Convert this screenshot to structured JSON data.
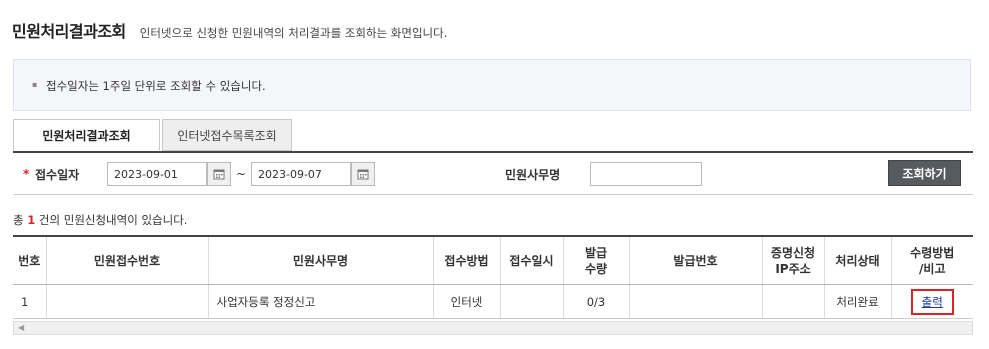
{
  "page": {
    "title": "민원처리결과조회",
    "description": "인터넷으로 신청한 민원내역의 처리결과를 조회하는 화면입니다."
  },
  "notice": {
    "bullet": "▪",
    "text": "접수일자는 1주일 단위로 조회할 수 있습니다."
  },
  "tabs": [
    {
      "label": "민원처리결과조회",
      "active": true
    },
    {
      "label": "인터넷접수목록조회",
      "active": false
    }
  ],
  "search": {
    "required_mark": "*",
    "date_label": "접수일자",
    "date_from": "2023-09-01",
    "date_to": "2023-09-07",
    "range_separator": "~",
    "office_label": "민원사무명",
    "office_value": "",
    "button": "조회하기"
  },
  "result_count": {
    "prefix": "총",
    "count": "1",
    "suffix": "건의 민원신청내역이 있습니다."
  },
  "table": {
    "headers": [
      "번호",
      "민원접수번호",
      "민원사무명",
      "접수방법",
      "접수일시",
      "발급\n수량",
      "발급번호",
      "증명신청\nIP주소",
      "처리상태",
      "수령방법\n/비고"
    ],
    "rows": [
      {
        "no": "1",
        "receipt_no": "",
        "office_name": "사업자등록 정정신고",
        "method": "인터넷",
        "received_at": "",
        "quantity": "0/3",
        "issue_no": "",
        "ip": "",
        "status": "처리완료",
        "action": "출력"
      }
    ]
  },
  "icons": {
    "calendar": "calendar-icon",
    "scroll_left": "scroll-left-arrow-icon"
  },
  "colors": {
    "accent_red": "#d8232a",
    "button_dark": "#555b61",
    "link_blue": "#1a3d9c"
  }
}
